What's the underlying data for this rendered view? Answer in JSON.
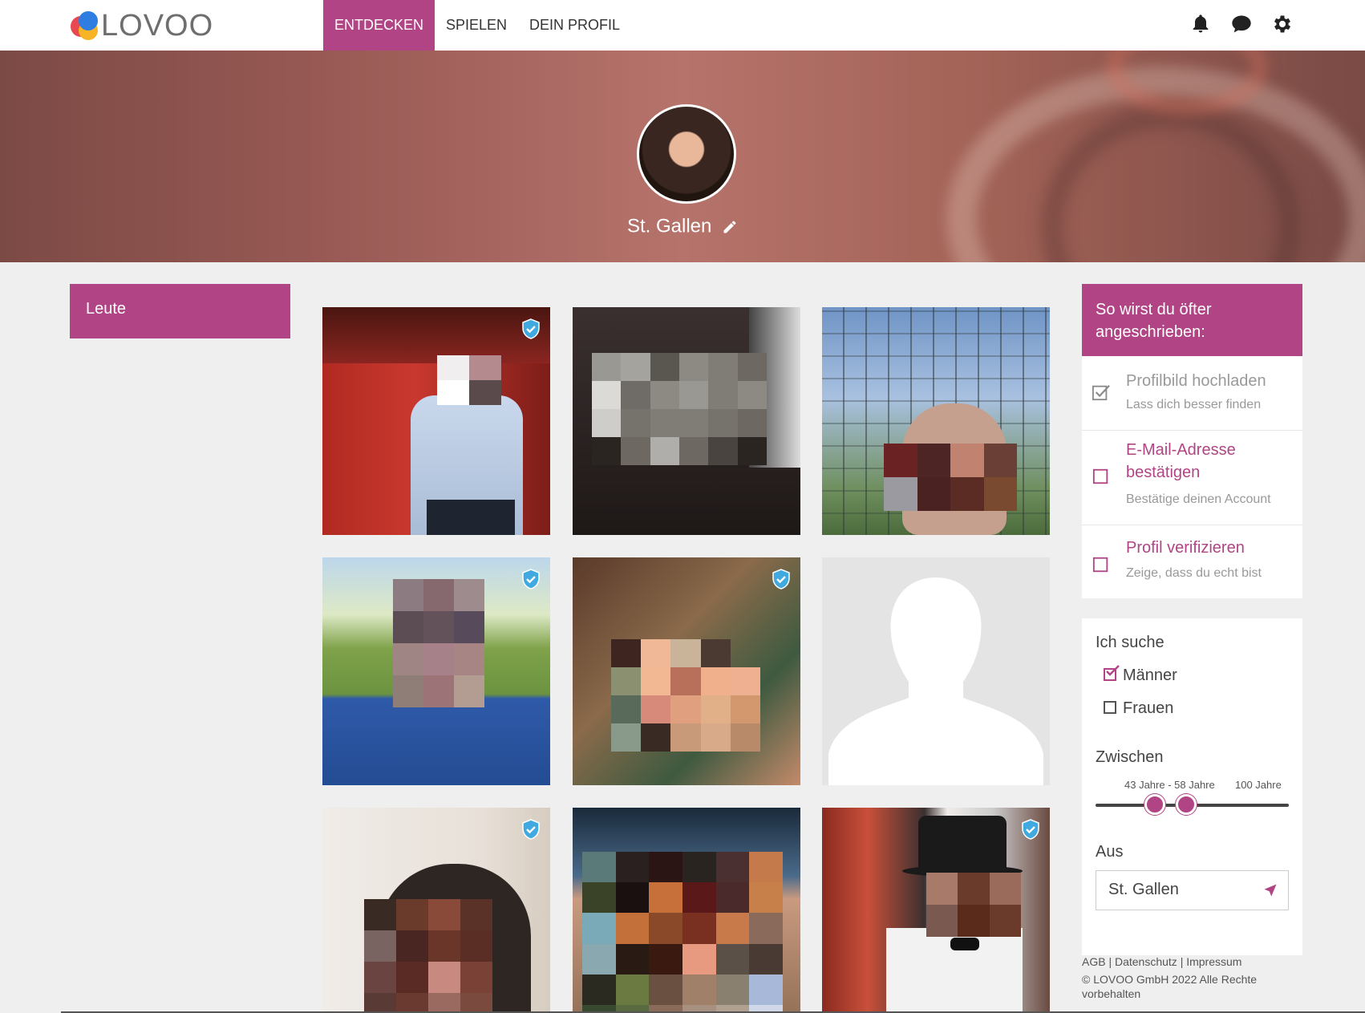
{
  "app": {
    "logo_text": "LOVOO",
    "brand_color": "#b14484"
  },
  "nav": {
    "tabs": [
      {
        "label": "ENTDECKEN",
        "active": true
      },
      {
        "label": "SPIELEN",
        "active": false
      },
      {
        "label": "DEIN PROFIL",
        "active": false
      }
    ],
    "icons": [
      "bell-icon",
      "chat-icon",
      "gear-icon"
    ]
  },
  "banner": {
    "city": "St. Gallen"
  },
  "sidebar": {
    "title": "Leute"
  },
  "grid": {
    "profiles": [
      {
        "verified": true
      },
      {
        "verified": false
      },
      {
        "verified": false
      },
      {
        "verified": true
      },
      {
        "verified": true
      },
      {
        "verified": false,
        "placeholder": true
      },
      {
        "verified": true
      },
      {
        "verified": false
      },
      {
        "verified": true
      }
    ]
  },
  "tips": {
    "title": "So wirst du öfter angeschrieben:",
    "items": [
      {
        "title": "Profilbild hochladen",
        "subtitle": "Lass dich besser finden",
        "done": true
      },
      {
        "title": "E-Mail-Adresse bestätigen",
        "subtitle": "Bestätige deinen Account",
        "done": false
      },
      {
        "title": "Profil verifizieren",
        "subtitle": "Zeige, dass du echt bist",
        "done": false
      }
    ]
  },
  "search": {
    "looking_for_label": "Ich suche",
    "options": [
      {
        "label": "Männer",
        "checked": true
      },
      {
        "label": "Frauen",
        "checked": false
      }
    ],
    "between_label": "Zwischen",
    "age_range_text": "43 Jahre - 58 Jahre",
    "age_max_text": "100 Jahre",
    "age_min": 43,
    "age_max": 58,
    "from_label": "Aus",
    "city_value": "St. Gallen"
  },
  "footer": {
    "links": "AGB | Datenschutz | Impressum",
    "copyright": "© LOVOO GmbH 2022 Alle Rechte vorbehalten"
  }
}
